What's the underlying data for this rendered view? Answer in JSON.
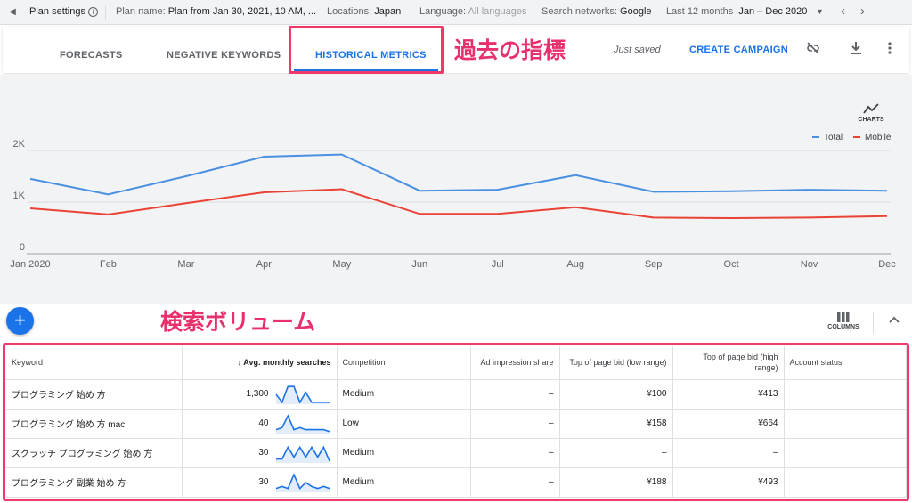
{
  "topbar": {
    "plan_settings": "Plan settings",
    "plan_name_label": "Plan name:",
    "plan_name_value": "Plan from Jan 30, 2021, 10 AM, ...",
    "locations_label": "Locations:",
    "locations_value": "Japan",
    "language_label": "Language:",
    "language_value": "All languages",
    "networks_label": "Search networks:",
    "networks_value": "Google",
    "period_label": "Last 12 months",
    "period_value": "Jan – Dec 2020"
  },
  "tabs": {
    "forecasts": "FORECASTS",
    "negative_keywords": "NEGATIVE KEYWORDS",
    "historical_metrics": "HISTORICAL METRICS"
  },
  "annotations": {
    "tab_note": "過去の指標",
    "volume_note": "検索ボリューム"
  },
  "actions": {
    "saved": "Just saved",
    "create_campaign": "CREATE CAMPAIGN",
    "charts_label": "CHARTS",
    "columns_label": "COLUMNS"
  },
  "icons": {
    "back": "caret-left-icon",
    "unlink": "link-off-icon",
    "download": "download-icon",
    "more": "more-vert-icon",
    "chart": "trend-line-icon",
    "add": "plus-icon",
    "columns": "columns-icon",
    "collapse": "chevron-up-icon"
  },
  "colors": {
    "total": "#4a90e2",
    "mobile": "#ea4335",
    "accent": "#1a73e8",
    "highlight": "#f0386b"
  },
  "chart_data": {
    "type": "line",
    "categories": [
      "Jan 2020",
      "Feb",
      "Mar",
      "Apr",
      "May",
      "Jun",
      "Jul",
      "Aug",
      "Sep",
      "Oct",
      "Nov",
      "Dec"
    ],
    "series": [
      {
        "name": "Total",
        "values": [
          1450,
          1150,
          1500,
          1880,
          1920,
          1220,
          1240,
          1520,
          1200,
          1210,
          1240,
          1220
        ]
      },
      {
        "name": "Mobile",
        "values": [
          880,
          760,
          980,
          1190,
          1250,
          770,
          770,
          900,
          700,
          690,
          700,
          730
        ]
      }
    ],
    "yticks": [
      "0",
      "1K",
      "2K"
    ],
    "ylim": [
      0,
      2000
    ],
    "grid": true,
    "legend": "top-right"
  },
  "table": {
    "headers": {
      "keyword": "Keyword",
      "avg_searches": "Avg. monthly searches",
      "competition": "Competition",
      "impression_share": "Ad impression share",
      "bid_low": "Top of page bid (low range)",
      "bid_high": "Top of page bid (high range)",
      "account_status": "Account status"
    },
    "sort_icon": "arrow-down-icon",
    "rows": [
      {
        "keyword": "プログラミング 始め 方",
        "searches": "1,300",
        "trend": [
          0.5,
          0.1,
          0.9,
          0.9,
          0.1,
          0.6,
          0.1,
          0.1,
          0.1,
          0.1
        ],
        "competition": "Medium",
        "impression_share": "–",
        "bid_low": "¥100",
        "bid_high": "¥413",
        "status": ""
      },
      {
        "keyword": "プログラミング 始め 方 mac",
        "searches": "40",
        "trend": [
          0.2,
          0.3,
          0.9,
          0.2,
          0.3,
          0.2,
          0.2,
          0.2,
          0.2,
          0.1
        ],
        "competition": "Low",
        "impression_share": "–",
        "bid_low": "¥158",
        "bid_high": "¥664",
        "status": ""
      },
      {
        "keyword": "スクラッチ プログラミング 始め 方",
        "searches": "30",
        "trend": [
          0.2,
          0.2,
          0.8,
          0.3,
          0.8,
          0.3,
          0.8,
          0.3,
          0.8,
          0.1
        ],
        "competition": "Medium",
        "impression_share": "–",
        "bid_low": "–",
        "bid_high": "–",
        "status": ""
      },
      {
        "keyword": "プログラミング 副業 始め 方",
        "searches": "30",
        "trend": [
          0.2,
          0.3,
          0.2,
          0.9,
          0.2,
          0.5,
          0.3,
          0.2,
          0.3,
          0.2
        ],
        "competition": "Medium",
        "impression_share": "–",
        "bid_low": "¥188",
        "bid_high": "¥493",
        "status": ""
      }
    ]
  }
}
